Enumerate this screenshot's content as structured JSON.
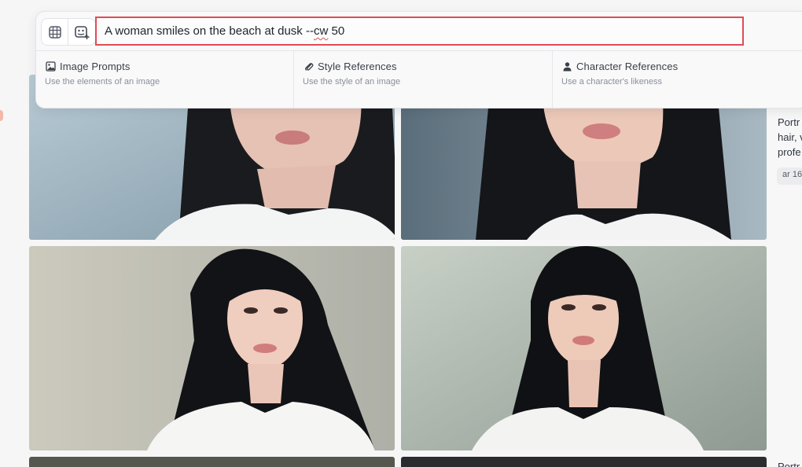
{
  "prompt": {
    "text_before": "A woman smiles on the beach at dusk --",
    "text_flagged": "cw",
    "text_after": " 50"
  },
  "toolbar": {
    "grid_icon": "grid-view-icon",
    "add_image_icon": "image-add-icon"
  },
  "references": [
    {
      "title": "Image Prompts",
      "subtitle": "Use the elements of an image",
      "icon": "image-icon"
    },
    {
      "title": "Style References",
      "subtitle": "Use the style of an image",
      "icon": "paperclip-icon"
    },
    {
      "title": "Character References",
      "subtitle": "Use a character's likeness",
      "icon": "person-icon"
    }
  ],
  "side_panel": {
    "description_lines": [
      "Portr",
      "hair, v",
      "profe"
    ],
    "chip": "ar 16",
    "bottom_text": "Portr"
  },
  "colors": {
    "highlight_border": "#e14b55",
    "panel_bg": "#f9f9fa"
  }
}
